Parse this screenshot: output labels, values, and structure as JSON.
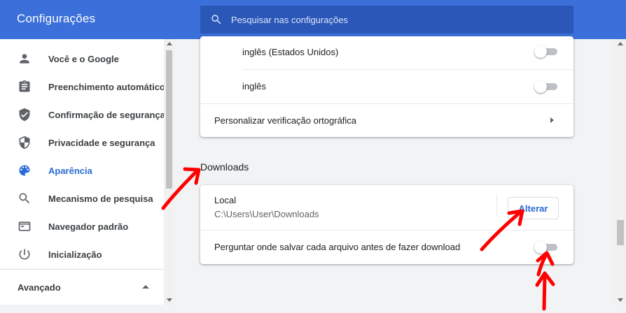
{
  "header": {
    "title": "Configurações",
    "search_placeholder": "Pesquisar nas configurações",
    "search_value": "",
    "accent_color": "#3b6fd9"
  },
  "sidebar": {
    "items": [
      {
        "label": "Você e o Google",
        "icon": "person-icon",
        "active": false
      },
      {
        "label": "Preenchimento automático",
        "icon": "clipboard-icon",
        "active": false
      },
      {
        "label": "Confirmação de segurança",
        "icon": "shield-check-icon",
        "active": false
      },
      {
        "label": "Privacidade e segurança",
        "icon": "shield-icon",
        "active": false
      },
      {
        "label": "Aparência",
        "icon": "palette-icon",
        "active": true
      },
      {
        "label": "Mecanismo de pesquisa",
        "icon": "search-icon",
        "active": false
      },
      {
        "label": "Navegador padrão",
        "icon": "browser-window-icon",
        "active": false
      },
      {
        "label": "Inicialização",
        "icon": "power-icon",
        "active": false
      }
    ],
    "advanced_label": "Avançado",
    "active_color": "#2a6bd6"
  },
  "spellcheck": {
    "languages": [
      {
        "label": "inglês (Estados Unidos)",
        "enabled": false
      },
      {
        "label": "inglês",
        "enabled": false
      }
    ],
    "customize_label": "Personalizar verificação ortográfica"
  },
  "downloads": {
    "section_title": "Downloads",
    "location_label": "Local",
    "location_path": "C:\\Users\\User\\Downloads",
    "change_button": "Alterar",
    "ask_label": "Perguntar onde salvar cada arquivo antes de fazer download",
    "ask_enabled": false
  },
  "annotations": {
    "arrow_color": "#ff0000",
    "arrow_count": 4
  }
}
